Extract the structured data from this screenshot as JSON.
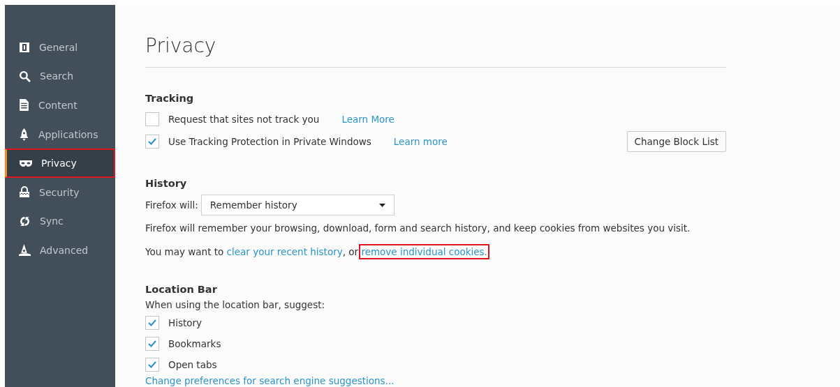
{
  "sidebar": {
    "items": [
      {
        "label": "General",
        "selected": false,
        "highlighted": false
      },
      {
        "label": "Search",
        "selected": false,
        "highlighted": false
      },
      {
        "label": "Content",
        "selected": false,
        "highlighted": false
      },
      {
        "label": "Applications",
        "selected": false,
        "highlighted": false
      },
      {
        "label": "Privacy",
        "selected": true,
        "highlighted": true
      },
      {
        "label": "Security",
        "selected": false,
        "highlighted": false
      },
      {
        "label": "Sync",
        "selected": false,
        "highlighted": false
      },
      {
        "label": "Advanced",
        "selected": false,
        "highlighted": false
      }
    ]
  },
  "page_title": "Privacy",
  "tracking": {
    "heading": "Tracking",
    "options": [
      {
        "label": "Request that sites not track you",
        "checked": false,
        "link": "Learn More"
      },
      {
        "label": "Use Tracking Protection in Private Windows",
        "checked": true,
        "link": "Learn more",
        "button": "Change Block List"
      }
    ]
  },
  "history": {
    "heading": "History",
    "select_label": "Firefox will:",
    "select_value": "Remember history",
    "description": "Firefox will remember your browsing, download, form and search history, and keep cookies from websites you visit.",
    "hint_prefix": "You may want to",
    "link_1": "clear your recent history",
    "hint_middle": ", or",
    "link_2": "remove individual cookies.",
    "link_2_highlighted": true
  },
  "location_bar": {
    "heading": "Location Bar",
    "description": "When using the location bar, suggest:",
    "options": [
      {
        "label": "History",
        "checked": true
      },
      {
        "label": "Bookmarks",
        "checked": true
      },
      {
        "label": "Open tabs",
        "checked": true
      }
    ],
    "link": "Change preferences for search engine suggestions..."
  }
}
